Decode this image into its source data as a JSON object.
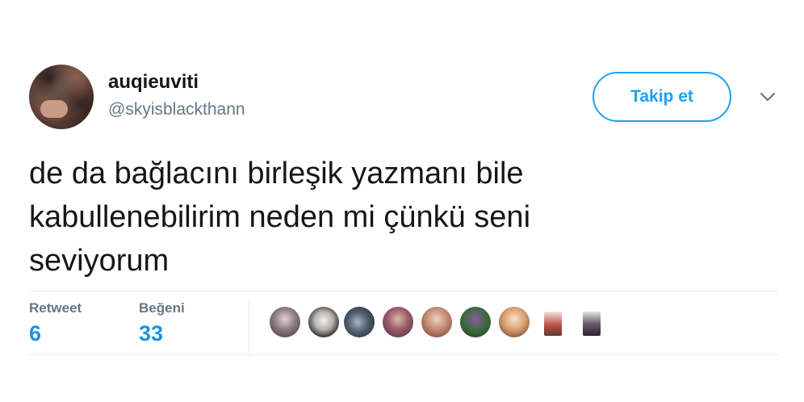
{
  "user": {
    "display_name": "auqieuviti",
    "handle": "@skyisblackthann"
  },
  "follow_button": {
    "label": "Takip et"
  },
  "tweet": {
    "lines": [
      "de da bağlacını birleşik yazmanı bile",
      "kabullenebilirim neden mi çünkü seni",
      "seviyorum"
    ]
  },
  "stats": {
    "retweet_label": "Retweet",
    "retweet_count": "6",
    "like_label": "Beğeni",
    "like_count": "33"
  },
  "icons": {
    "more": "chevron-down-icon"
  },
  "colors": {
    "accent": "#1da1f2",
    "stat_value": "#1b95e0",
    "secondary_text": "#657786",
    "primary_text": "#14171a",
    "divider": "#e6ecf0"
  }
}
